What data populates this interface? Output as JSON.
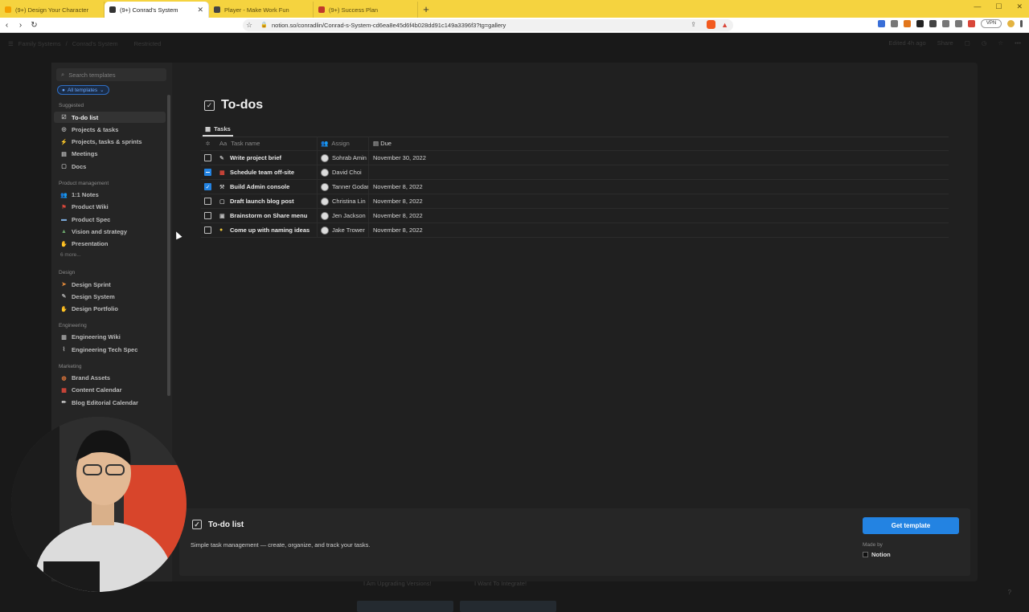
{
  "browser": {
    "tabs": [
      {
        "label": "(9+) Design Your Character",
        "favicon_color": "#f4a000",
        "active": false
      },
      {
        "label": "(9+) Conrad's System",
        "favicon_color": "#333333",
        "active": true
      },
      {
        "label": "Player - Make Work Fun",
        "favicon_color": "#444444",
        "active": false
      },
      {
        "label": "(9+) Success Plan",
        "favicon_color": "#c0392b",
        "active": false
      }
    ],
    "new_tab": "+",
    "url": "notion.so/conradlin/Conrad-s-System-cd6ea8e45d6f4b028dd91c149a3396f3?tg=gallery",
    "vpn_label": "VPN"
  },
  "notion": {
    "breadcrumb": [
      "Family Systems",
      "Conrad's System",
      "Restricted"
    ],
    "top_right": [
      "Edited 4h ago",
      "Share"
    ]
  },
  "sidebar": {
    "search_placeholder": "Search templates",
    "filter_label": "All templates",
    "sections": [
      {
        "title": "Suggested",
        "items": [
          {
            "label": "To-do list",
            "icon": "checkbox-icon",
            "selected": true
          },
          {
            "label": "Projects & tasks",
            "icon": "target-icon"
          },
          {
            "label": "Projects, tasks & sprints",
            "icon": "runner-icon"
          },
          {
            "label": "Meetings",
            "icon": "notes-icon"
          },
          {
            "label": "Docs",
            "icon": "doc-icon"
          }
        ]
      },
      {
        "title": "Product management",
        "items": [
          {
            "label": "1:1 Notes",
            "icon": "people-icon"
          },
          {
            "label": "Product Wiki",
            "icon": "wiki-icon"
          },
          {
            "label": "Product Spec",
            "icon": "spec-icon"
          },
          {
            "label": "Vision and strategy",
            "icon": "mountain-icon"
          },
          {
            "label": "Presentation",
            "icon": "hands-icon"
          }
        ],
        "more": "6 more..."
      },
      {
        "title": "Design",
        "items": [
          {
            "label": "Design Sprint",
            "icon": "sprint-icon"
          },
          {
            "label": "Design System",
            "icon": "pen-icon"
          },
          {
            "label": "Design Portfolio",
            "icon": "wave-icon"
          }
        ]
      },
      {
        "title": "Engineering",
        "items": [
          {
            "label": "Engineering Wiki",
            "icon": "book-icon"
          },
          {
            "label": "Engineering Tech Spec",
            "icon": "paperclip-icon"
          }
        ]
      },
      {
        "title": "Marketing",
        "items": [
          {
            "label": "Brand Assets",
            "icon": "palette-icon"
          },
          {
            "label": "Content Calendar",
            "icon": "calendar-icon"
          },
          {
            "label": "Blog Editorial Calendar",
            "icon": "pencil-icon"
          }
        ]
      }
    ]
  },
  "preview": {
    "title": "To-dos",
    "view_tab": "Tasks",
    "columns": {
      "name": "Task name",
      "name_prefix": "Aa",
      "assign": "Assign",
      "due": "Due"
    },
    "rows": [
      {
        "state": "unchecked",
        "icon": "pen-icon",
        "name": "Write project brief",
        "assign": "Sohrab Amin",
        "due": "November 30, 2022"
      },
      {
        "state": "partial",
        "icon": "calendar-icon",
        "name": "Schedule team off-site",
        "assign": "David Choi",
        "due": ""
      },
      {
        "state": "checked",
        "icon": "hammer-icon",
        "name": "Build Admin console",
        "assign": "Tanner Godarzi",
        "due": "November 8, 2022"
      },
      {
        "state": "unchecked",
        "icon": "doc-icon",
        "name": "Draft launch blog post",
        "assign": "Christina Lin",
        "due": "November 8, 2022"
      },
      {
        "state": "unchecked",
        "icon": "board-icon",
        "name": "Brainstorm on Share menu",
        "assign": "Jen Jackson",
        "due": "November 8, 2022"
      },
      {
        "state": "unchecked",
        "icon": "bulb-icon",
        "name": "Come up with naming ideas",
        "assign": "Jake Trower",
        "due": "November 8, 2022"
      }
    ]
  },
  "footer": {
    "title": "To-do list",
    "description": "Simple task management — create, organize, and track your tasks.",
    "button": "Get template",
    "made_by_label": "Made by",
    "made_by": "Notion"
  },
  "below_modal": [
    "I Am Upgrading Versions!",
    "I Want To Integrate!"
  ],
  "help": "?"
}
